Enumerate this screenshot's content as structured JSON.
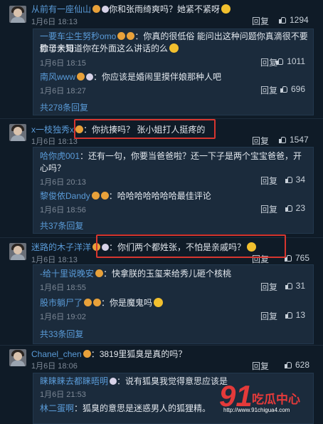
{
  "reply_label": "回复",
  "comments": [
    {
      "user": "从前有一座仙山",
      "text": "你和张雨绮爽吗？她紧不紧呀",
      "date": "1月6日 18:13",
      "likes": "1294",
      "replies": [
        {
          "user": "一要车尘生努秒omo",
          "text": "：你真的很低俗 能问出这种问题你真滴很不要脸了大哥",
          "text2": "你母亲知道你在外面这么讲话的么",
          "date": "1月6日 18:15",
          "likes": "1011"
        },
        {
          "user": "南风www",
          "text": "：你应该是婚闹里摸伴娘那种人吧",
          "date": "1月6日 18:27",
          "likes": "696"
        }
      ],
      "more": "共278条回复"
    },
    {
      "user": "x一枝独秀x",
      "text": "你抗揍吗？ 张小姐打人挺疼的",
      "date": "1月6日 18:13",
      "likes": "1547",
      "replies": [
        {
          "user": "哈你虎001",
          "text": "：还有一句，你要当爸爸啦？还一下子是两个宝宝爸爸，开心吗？",
          "text2": "心吗？",
          "date": "1月6日 20:13",
          "likes": "34"
        },
        {
          "user": "黎俊依Dandy",
          "text": "：哈哈哈哈哈哈哈最佳评论",
          "date": "1月6日 18:56",
          "likes": "23"
        }
      ],
      "more": "共37条回复"
    },
    {
      "user": "迷路的木子洋洋",
      "text": "：你们两个都姓张，不怕是亲戚吗？",
      "date": "1月6日 18:13",
      "likes": "765",
      "replies": [
        {
          "user": "-给十里说晚安",
          "text": "：快拿朕的玉玺来给秀儿砸个核桃",
          "date": "1月6日 18:55",
          "likes": "31"
        },
        {
          "user": "股市躺尸了",
          "text": "：你是魔鬼吗",
          "date": "1月6日 19:02",
          "likes": "13"
        }
      ],
      "more": "共33条回复"
    },
    {
      "user": "Chanel_chen",
      "text": "：3819里狐臭是真的吗？",
      "date": "1月6日 18:06",
      "likes": "628",
      "replies": [
        {
          "user": "睐睐睐去都睐晤明",
          "text": "：说有狐臭我觉得意思应该是",
          "date": "1月6日 21:53",
          "likes": ""
        },
        {
          "user": "林二蛋啊",
          "text": "：狐臭的意思是迷惑男人的狐狸精。",
          "date": "",
          "likes": ""
        }
      ],
      "more": ""
    }
  ],
  "watermark": {
    "logo": "91",
    "brand": "吃瓜中心",
    "url": "http://www.91chigua4.com"
  },
  "colors": {
    "background": "#0f1b27",
    "username": "#5a9bd8",
    "highlight_box": "#d7362f",
    "watermark": "#e43a3a"
  }
}
